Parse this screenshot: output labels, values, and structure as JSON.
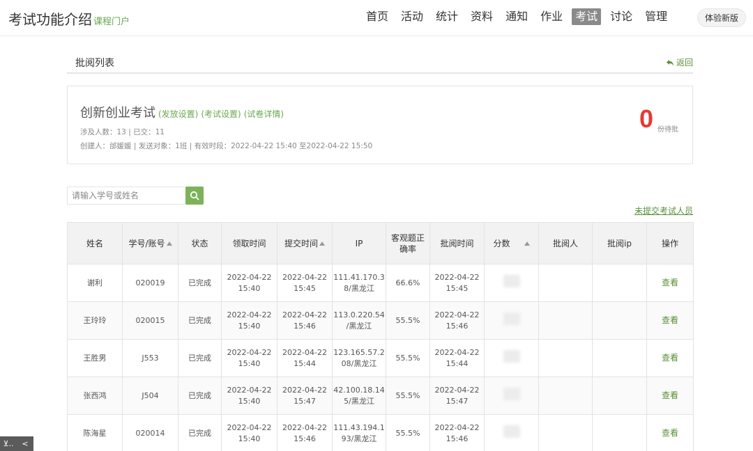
{
  "header": {
    "title": "考试功能介绍",
    "subtitle": "课程门户",
    "nav": [
      "首页",
      "活动",
      "统计",
      "资料",
      "通知",
      "作业",
      "考试",
      "讨论",
      "管理"
    ],
    "active_nav": "考试",
    "try_new": "体验新版"
  },
  "section": {
    "title": "批阅列表",
    "back": "返回"
  },
  "exam": {
    "name": "创新创业考试",
    "links": [
      "(发放设置)",
      "(考试设置)",
      "(试卷详情)"
    ],
    "meta1": "涉及人数：13 | 已交：11",
    "meta2": "创建人：邰媛媛 | 发送对象：1班 | 有效时段：2022-04-22 15:40 至2022-04-22 15:50",
    "pending_count": "0",
    "pending_label": "份待批"
  },
  "search": {
    "placeholder": "请输入学号或姓名"
  },
  "unsubmitted_link": "未提交考试人员",
  "table": {
    "headers": [
      "姓名",
      "学号/账号",
      "状态",
      "领取时间",
      "提交时间",
      "IP",
      "客观题正确率",
      "批阅时间",
      "分数",
      "批阅人",
      "批阅ip",
      "操作"
    ],
    "sortable": [
      false,
      true,
      false,
      false,
      true,
      false,
      false,
      false,
      true,
      false,
      false,
      false
    ],
    "rows": [
      {
        "name": "谢利",
        "id": "020019",
        "status": "已完成",
        "get_date": "2022-04-22",
        "get_time": "15:40",
        "sub_date": "2022-04-22",
        "sub_time": "15:45",
        "ip1": "111.41.170.3",
        "ip2": "8/黑龙江",
        "rate": "66.6%",
        "rev_date": "2022-04-22",
        "rev_time": "15:45",
        "action": "查看"
      },
      {
        "name": "王玲玲",
        "id": "020015",
        "status": "已完成",
        "get_date": "2022-04-22",
        "get_time": "15:40",
        "sub_date": "2022-04-22",
        "sub_time": "15:46",
        "ip1": "113.0.220.54",
        "ip2": "/黑龙江",
        "rate": "55.5%",
        "rev_date": "2022-04-22",
        "rev_time": "15:46",
        "action": "查看"
      },
      {
        "name": "王胜男",
        "id": "J553",
        "status": "已完成",
        "get_date": "2022-04-22",
        "get_time": "15:40",
        "sub_date": "2022-04-22",
        "sub_time": "15:44",
        "ip1": "123.165.57.2",
        "ip2": "08/黑龙江",
        "rate": "55.5%",
        "rev_date": "2022-04-22",
        "rev_time": "15:44",
        "action": "查看"
      },
      {
        "name": "张西鸿",
        "id": "J504",
        "status": "已完成",
        "get_date": "2022-04-22",
        "get_time": "15:40",
        "sub_date": "2022-04-22",
        "sub_time": "15:47",
        "ip1": "42.100.18.14",
        "ip2": "5/黑龙江",
        "rate": "55.5%",
        "rev_date": "2022-04-22",
        "rev_time": "15:47",
        "action": "查看"
      },
      {
        "name": "陈海星",
        "id": "020014",
        "status": "已完成",
        "get_date": "2022-04-22",
        "get_time": "15:40",
        "sub_date": "2022-04-22",
        "sub_time": "15:46",
        "ip1": "111.43.194.1",
        "ip2": "93/黑龙江",
        "rate": "55.5%",
        "rev_date": "2022-04-22",
        "rev_time": "15:46",
        "action": "查看"
      }
    ]
  },
  "colors": {
    "accent_green": "#6aa84f",
    "link_green": "#5b8f3a",
    "pending_red": "#e53935",
    "active_nav_bg": "#8a8a8a"
  },
  "corner": {
    "left": "⊻..",
    "right": "<"
  }
}
